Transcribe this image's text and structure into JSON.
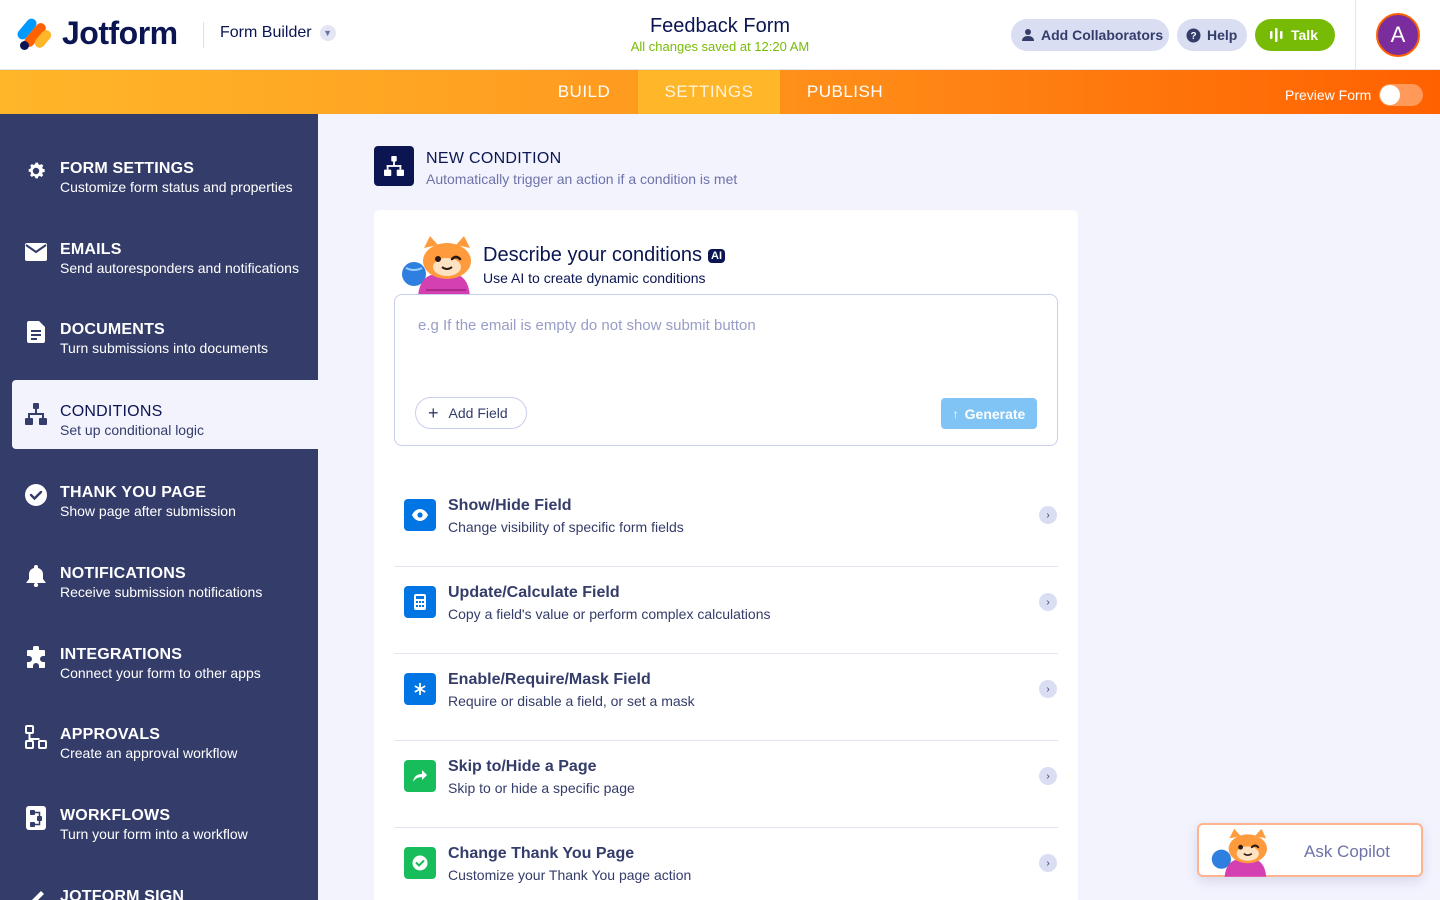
{
  "header": {
    "brand": "Jotform",
    "product_switcher": "Form Builder",
    "form_title": "Feedback Form",
    "save_status": "All changes saved at 12:20 AM",
    "add_collaborators": "Add Collaborators",
    "help": "Help",
    "talk": "Talk",
    "avatar_initial": "A"
  },
  "nav": {
    "tabs": [
      {
        "label": "BUILD"
      },
      {
        "label": "SETTINGS"
      },
      {
        "label": "PUBLISH"
      }
    ],
    "active_tab": "SETTINGS",
    "preview_form": "Preview Form",
    "preview_enabled": false
  },
  "sidebar": {
    "items": [
      {
        "title": "FORM SETTINGS",
        "desc": "Customize form status and properties",
        "icon": "gear-icon"
      },
      {
        "title": "EMAILS",
        "desc": "Send autoresponders and notifications",
        "icon": "envelope-icon"
      },
      {
        "title": "DOCUMENTS",
        "desc": "Turn submissions into documents",
        "icon": "document-icon"
      },
      {
        "title": "CONDITIONS",
        "desc": "Set up conditional logic",
        "icon": "conditions-icon"
      },
      {
        "title": "THANK YOU PAGE",
        "desc": "Show page after submission",
        "icon": "check-circle-icon"
      },
      {
        "title": "NOTIFICATIONS",
        "desc": "Receive submission notifications",
        "icon": "bell-icon"
      },
      {
        "title": "INTEGRATIONS",
        "desc": "Connect your form to other apps",
        "icon": "puzzle-icon"
      },
      {
        "title": "APPROVALS",
        "desc": "Create an approval workflow",
        "icon": "approval-flow-icon"
      },
      {
        "title": "WORKFLOWS",
        "desc": "Turn your form into a workflow",
        "icon": "workflow-icon"
      },
      {
        "title": "JOTFORM SIGN",
        "desc": "",
        "icon": "sign-icon"
      }
    ],
    "active": "CONDITIONS"
  },
  "main": {
    "section_title": "NEW CONDITION",
    "section_subtitle": "Automatically trigger an action if a condition is met",
    "ai": {
      "title": "Describe your conditions",
      "badge": "AI",
      "subtitle": "Use AI to create dynamic conditions",
      "placeholder": "e.g If the email is empty do not show submit button",
      "value": "",
      "add_field": "Add Field",
      "generate": "Generate"
    },
    "actions": [
      {
        "title": "Show/Hide Field",
        "desc": "Change visibility of specific form fields",
        "icon": "eye-icon",
        "color": "#0075e3"
      },
      {
        "title": "Update/Calculate Field",
        "desc": "Copy a field's value or perform complex calculations",
        "icon": "calculator-icon",
        "color": "#0075e3"
      },
      {
        "title": "Enable/Require/Mask Field",
        "desc": "Require or disable a field, or set a mask",
        "icon": "asterisk-icon",
        "color": "#0075e3"
      },
      {
        "title": "Skip to/Hide a Page",
        "desc": "Skip to or hide a specific page",
        "icon": "skip-arrow-icon",
        "color": "#18bd5b"
      },
      {
        "title": "Change Thank You Page",
        "desc": "Customize your Thank You page action",
        "icon": "check-circle-icon",
        "color": "#18bd5b"
      }
    ]
  },
  "copilot": {
    "label": "Ask Copilot"
  },
  "colors": {
    "accent_orange": "#ff6100",
    "nav_gradient_start": "#ffb629",
    "sidebar_bg": "#343c6a",
    "talk_green": "#78bb07",
    "generate_blue": "#7fc4f4"
  }
}
